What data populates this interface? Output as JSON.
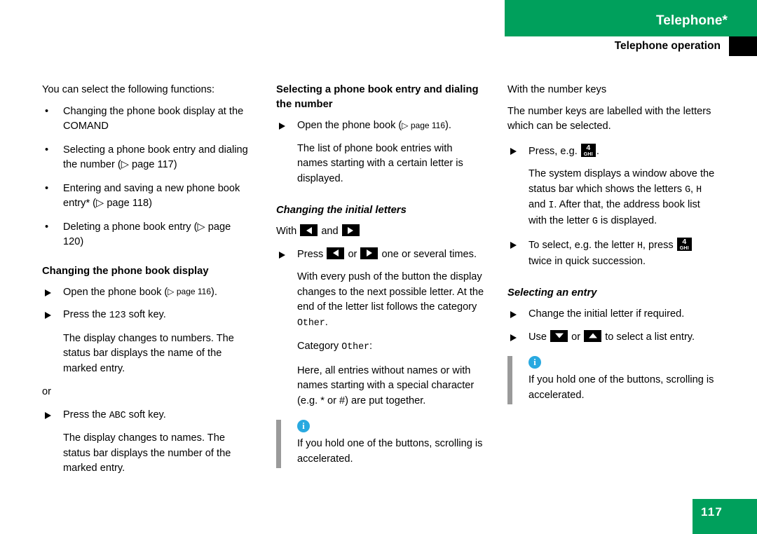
{
  "header": {
    "chapter_title": "Telephone*",
    "section_title": "Telephone operation",
    "green": "#00a05c"
  },
  "footer": {
    "page_number": "117"
  },
  "left_column": {
    "intro": "You can select the following functions:",
    "bullets": [
      {
        "bullet": "•",
        "text": "Changing the phone book display at the COMAND"
      },
      {
        "bullet": "•",
        "text": "Selecting a phone book entry and dialing the number (▷ page 117)"
      },
      {
        "bullet": "•",
        "text": "Entering and saving a new phone book entry* (▷ page 118)"
      },
      {
        "bullet": "•",
        "text": "Deleting a phone book entry (▷ page 120)"
      }
    ],
    "heading": "Changing the phone book display",
    "step1_pre": "Open the phone book (",
    "step1_ref": "▷ page 116",
    "step1_post": ").",
    "step2_pre": "Press the ",
    "step2_key": "123",
    "step2_post": " soft key.",
    "result1": "The display changes to numbers. The status bar displays the name of the marked entry.",
    "or_label": "or",
    "step3_pre": "Press the ",
    "step3_key": "ABC",
    "step3_post": " soft key.",
    "result2": "The display changes to names. The status bar displays the number of the marked entry."
  },
  "mid_column": {
    "heading": "Selecting a phone book entry and dialing the number",
    "step1_pre": "Open the phone book (",
    "step1_ref": "▷ page 116",
    "step1_post": ").",
    "result1": "The list of phone book entries with names starting with a certain letter is displayed.",
    "subheading": "Changing the initial letters",
    "with_label": "With",
    "and_label": "and",
    "press_label": "Press",
    "or_label": "or",
    "press_tail": "one or several times.",
    "result2_pre": "With every push of the button the display changes to the next possible letter. At the end of the letter list follows the category ",
    "result2_token": "Other",
    "result2_post": ".",
    "category_pre": "Category ",
    "category_token": "Other",
    "category_post": ":",
    "result3": "Here, all entries without names or with names starting with a special character (e.g. * or #) are put together.",
    "note_icon_glyph": "i",
    "note_text": "If you hold one of the buttons, scrolling is accelerated."
  },
  "right_column": {
    "heading": "With the number keys",
    "intro": "The number keys are labelled with the letters which can be selected.",
    "step1_pre": "Press, e.g. ",
    "step1_post": ".",
    "key_digit": "4",
    "key_letters": "GHI",
    "result1_a": "The system displays a window above the status bar which shows the letters ",
    "result1_g": "G",
    "result1_b": ", ",
    "result1_h": "H",
    "result1_c": " and ",
    "result1_i": "I",
    "result1_d": ". After that, the address book list with the letter ",
    "result1_g2": "G",
    "result1_e": " is displayed.",
    "step2_pre": "To select, e.g. the letter ",
    "step2_letter": "H",
    "step2_mid": ", press ",
    "step2_post": "twice in quick succession.",
    "subheading": "Selecting an entry",
    "step3": "Change the initial letter if required.",
    "step4_pre": "Use",
    "step4_or": "or",
    "step4_post": "to select a list entry.",
    "note_icon_glyph": "i",
    "note_text": "If you hold one of the buttons, scrolling is accelerated."
  }
}
